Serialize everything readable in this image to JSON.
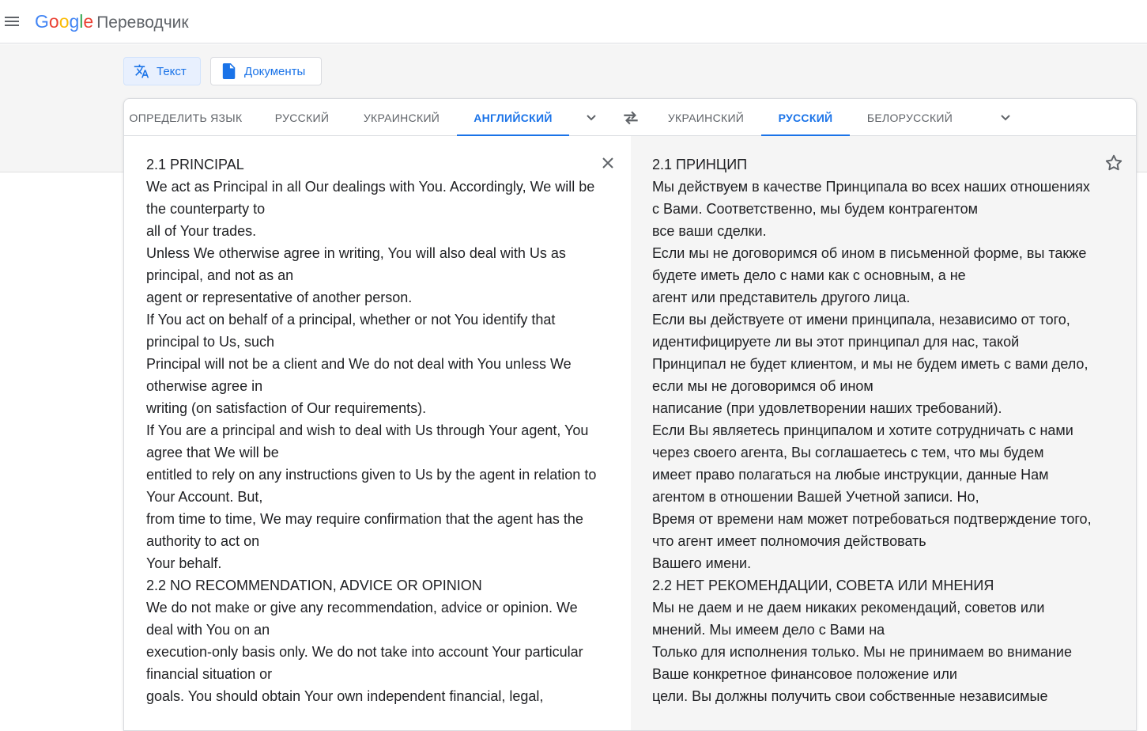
{
  "header": {
    "logo_letters": [
      {
        "char": "G",
        "color": "#4285F4"
      },
      {
        "char": "o",
        "color": "#EA4335"
      },
      {
        "char": "o",
        "color": "#FBBC05"
      },
      {
        "char": "g",
        "color": "#4285F4"
      },
      {
        "char": "l",
        "color": "#34A853"
      },
      {
        "char": "e",
        "color": "#EA4335"
      }
    ],
    "product_name": "Переводчик",
    "menu_icon": "hamburger-menu-icon"
  },
  "modes": {
    "text_label": "Текст",
    "text_icon": "translate-icon",
    "docs_label": "Документы",
    "docs_icon": "document-icon",
    "active": "text"
  },
  "source_languages": {
    "tabs": [
      "ОПРЕДЕЛИТЬ ЯЗЫК",
      "РУССКИЙ",
      "УКРАИНСКИЙ",
      "АНГЛИЙСКИЙ"
    ],
    "active": "АНГЛИЙСКИЙ"
  },
  "target_languages": {
    "tabs": [
      "УКРАИНСКИЙ",
      "РУССКИЙ",
      "БЕЛОРУССКИЙ"
    ],
    "active": "РУССКИЙ"
  },
  "source_text": "2.1 PRINCIPAL\nWe act as Principal in all Our dealings with You. Accordingly, We will be the counterparty to\nall of Your trades.\nUnless We otherwise agree in writing, You will also deal with Us as principal, and not as an\nagent or representative of another person.\nIf You act on behalf of a principal, whether or not You identify that principal to Us, such\nPrincipal will not be a client and We do not deal with You unless We otherwise agree in\nwriting (on satisfaction of Our requirements).\nIf You are a principal and wish to deal with Us through Your agent, You agree that We will be\nentitled to rely on any instructions given to Us by the agent in relation to Your Account. But,\nfrom time to time, We may require confirmation that the agent has the authority to act on\nYour behalf.\n2.2 NO RECOMMENDATION, ADVICE OR OPINION\nWe do not make or give any recommendation, advice or opinion. We deal with You on an\nexecution-only basis only. We do not take into account Your particular financial situation or\ngoals. You should obtain Your own independent financial, legal,",
  "translated_text": "2.1 ПРИНЦИП\nМы действуем в качестве Принципала во всех наших отношениях с Вами. Соответственно, мы будем контрагентом\nвсе ваши сделки.\nЕсли мы не договоримся об ином в письменной форме, вы также будете иметь дело с нами как с основным, а не\nагент или представитель другого лица.\nЕсли вы действуете от имени принципала, независимо от того, идентифицируете ли вы этот принципал для нас, такой\nПринципал не будет клиентом, и мы не будем иметь с вами дело, если мы не договоримся об ином\nнаписание (при удовлетворении наших требований).\nЕсли Вы являетесь принципалом и хотите сотрудничать с нами через своего агента, Вы соглашаетесь с тем, что мы будем\nимеет право полагаться на любые инструкции, данные Нам агентом в отношении Вашей Учетной записи. Но,\nВремя от времени нам может потребоваться подтверждение того, что агент имеет полномочия действовать\nВашего имени.\n2.2 НЕТ РЕКОМЕНДАЦИИ, СОВЕТА ИЛИ МНЕНИЯ\nМы не даем и не даем никаких рекомендаций, советов или мнений. Мы имеем дело с Вами на\nТолько для исполнения только. Мы не принимаем во внимание Ваше конкретное финансовое положение или\nцели. Вы должны получить свои собственные независимые",
  "icons": {
    "chevron": "chevron-down-icon",
    "swap": "swap-languages-icon",
    "clear": "close-icon",
    "save": "star-icon"
  },
  "colors": {
    "accent": "#1a73e8",
    "active_mode_bg": "#e8f0fe",
    "target_pane_bg": "#f5f5f5"
  }
}
